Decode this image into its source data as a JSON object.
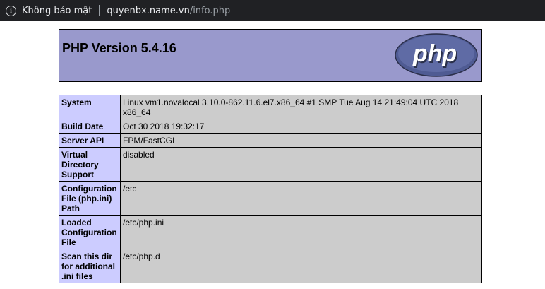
{
  "browser": {
    "security_label": "Không bảo mật",
    "url_host": "quyenbx.name.vn",
    "url_path": "/info.php",
    "icon": "info-icon"
  },
  "header": {
    "title": "PHP Version 5.4.16",
    "logo_text": "php"
  },
  "rows": [
    {
      "key": "System",
      "value": "Linux vm1.novalocal 3.10.0-862.11.6.el7.x86_64 #1 SMP Tue Aug 14 21:49:04 UTC 2018 x86_64"
    },
    {
      "key": "Build Date",
      "value": "Oct 30 2018 19:32:17"
    },
    {
      "key": "Server API",
      "value": "FPM/FastCGI"
    },
    {
      "key": "Virtual Directory Support",
      "value": "disabled"
    },
    {
      "key": "Configuration File (php.ini) Path",
      "value": "/etc"
    },
    {
      "key": "Loaded Configuration File",
      "value": "/etc/php.ini"
    },
    {
      "key": "Scan this dir for additional .ini files",
      "value": "/etc/php.d"
    }
  ]
}
